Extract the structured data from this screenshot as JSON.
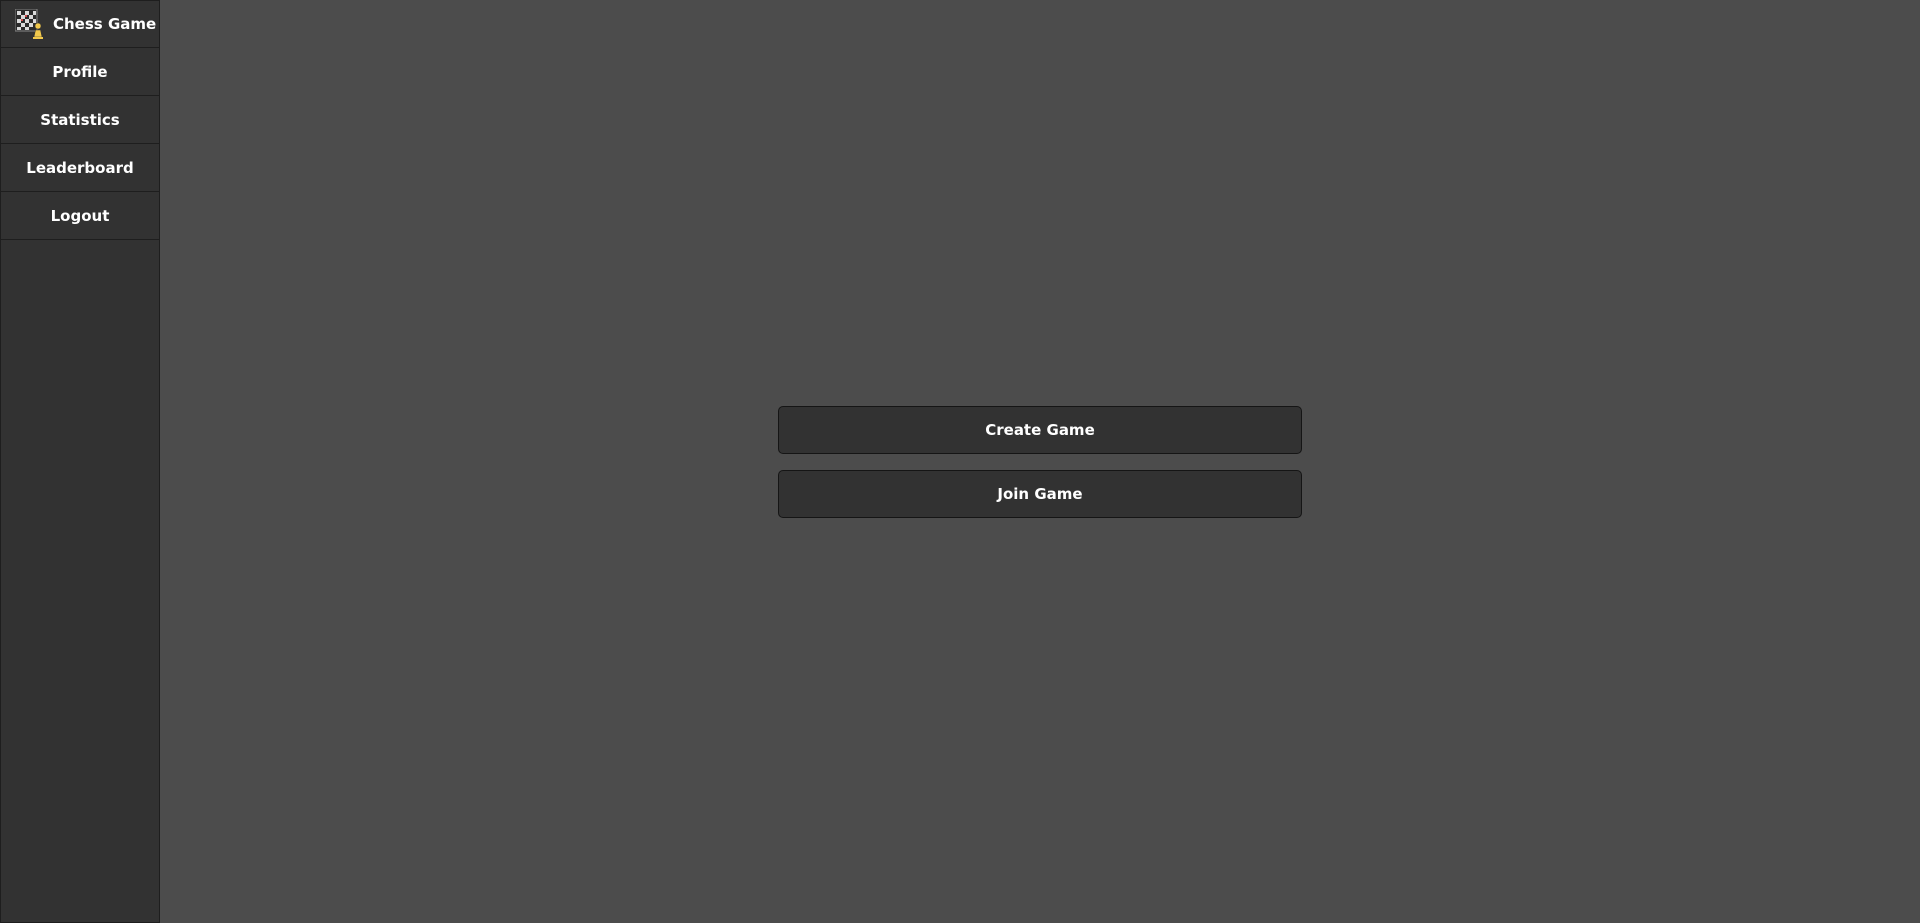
{
  "sidebar": {
    "brand": {
      "title": "Chess Game",
      "icon": "chessboard-pawn-logo-icon"
    },
    "items": [
      {
        "label": "Profile"
      },
      {
        "label": "Statistics"
      },
      {
        "label": "Leaderboard"
      },
      {
        "label": "Logout"
      }
    ]
  },
  "main": {
    "create_label": "Create Game",
    "join_label": "Join Game"
  },
  "colors": {
    "page_bg": "#4c4c4c",
    "sidebar_bg": "#323232",
    "button_bg": "#323232",
    "text": "#ffffff",
    "pawn": "#f2c94c"
  }
}
